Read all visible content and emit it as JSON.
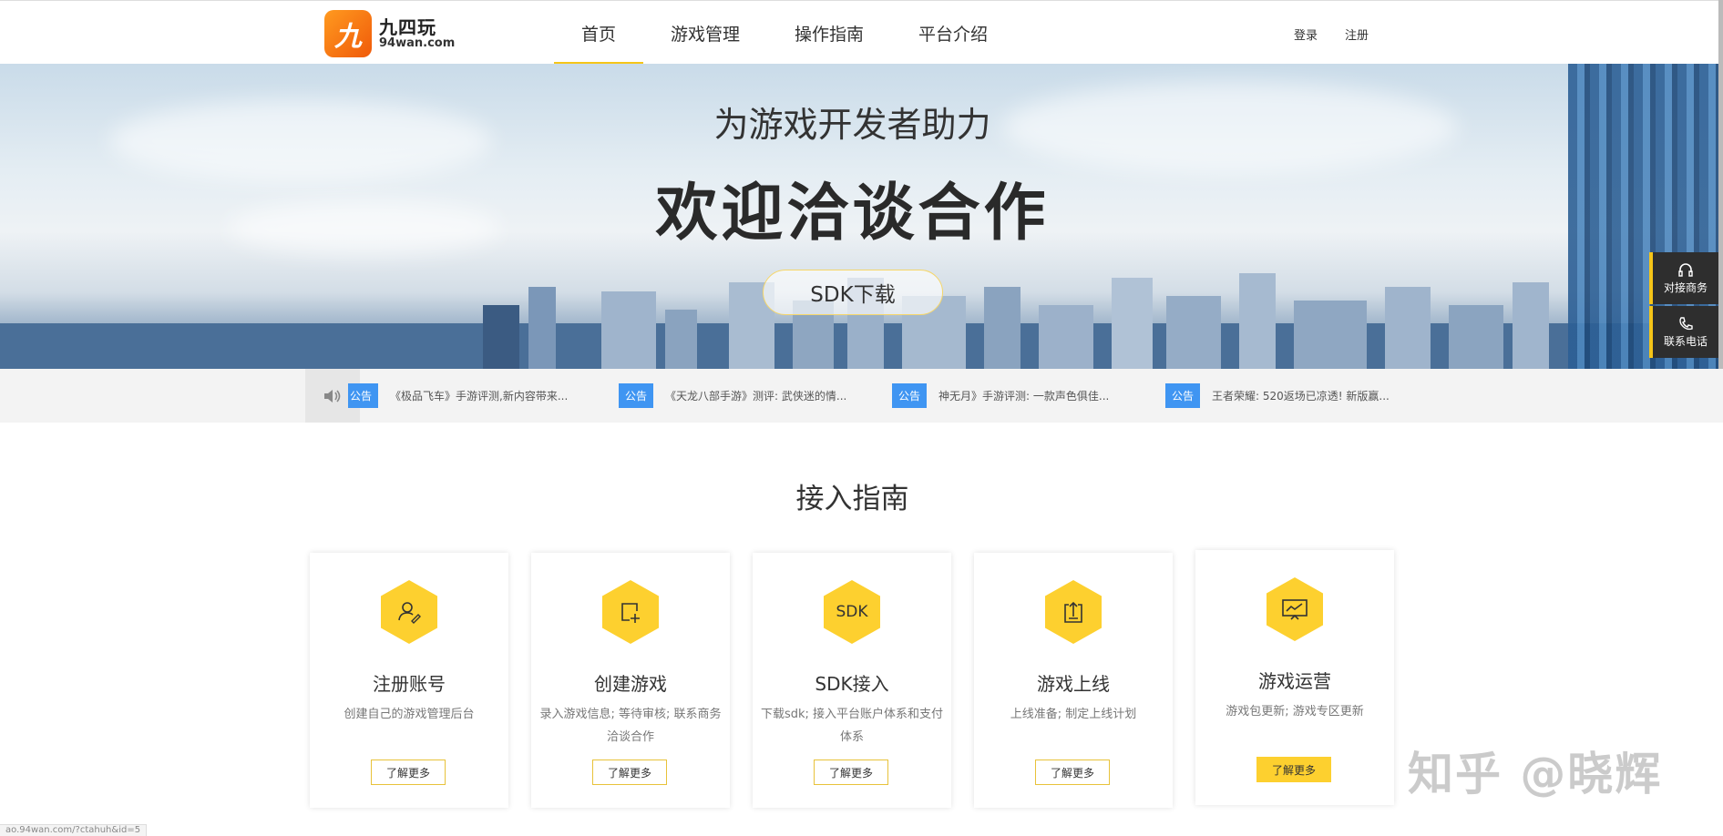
{
  "brand": {
    "logo_mark": "九",
    "name_cn": "九四玩",
    "name_en": "94wan.com"
  },
  "nav": {
    "items": [
      "首页",
      "游戏管理",
      "操作指南",
      "平台介绍"
    ],
    "active": "首页"
  },
  "auth": {
    "login": "登录",
    "register": "注册"
  },
  "hero": {
    "subtitle": "为游戏开发者助力",
    "title": "欢迎洽谈合作",
    "sdk_button": "SDK下载"
  },
  "notices": [
    {
      "tag": "公告",
      "text": "《极品飞车》手游评测,新内容带来..."
    },
    {
      "tag": "公告",
      "text": "《天龙八部手游》测评: 武侠迷的情..."
    },
    {
      "tag": "公告",
      "text": "神无月》手游评测: 一款声色俱佳..."
    },
    {
      "tag": "公告",
      "text": "王者荣耀: 520返场已凉透! 新版赢..."
    }
  ],
  "side": {
    "business": "对接商务",
    "phone": "联系电话"
  },
  "guide": {
    "title": "接入指南",
    "cards": [
      {
        "icon": "user-edit-icon",
        "name": "注册账号",
        "desc": "创建自己的游戏管理后台",
        "more": "了解更多"
      },
      {
        "icon": "add-square-icon",
        "name": "创建游戏",
        "desc": "录入游戏信息; 等待审核; 联系商务洽谈合作",
        "more": "了解更多"
      },
      {
        "icon": "sdk-icon",
        "name": "SDK接入",
        "desc": "下载sdk; 接入平台账户体系和支付体系",
        "more": "了解更多",
        "icon_text": "SDK"
      },
      {
        "icon": "upload-doc-icon",
        "name": "游戏上线",
        "desc": "上线准备; 制定上线计划",
        "more": "了解更多"
      },
      {
        "icon": "presentation-icon",
        "name": "游戏运营",
        "desc": "游戏包更新; 游戏专区更新",
        "more": "了解更多"
      }
    ]
  },
  "watermark": "知乎 @晓辉",
  "status_url": "ao.94wan.com/?ctahuh&id=5"
}
